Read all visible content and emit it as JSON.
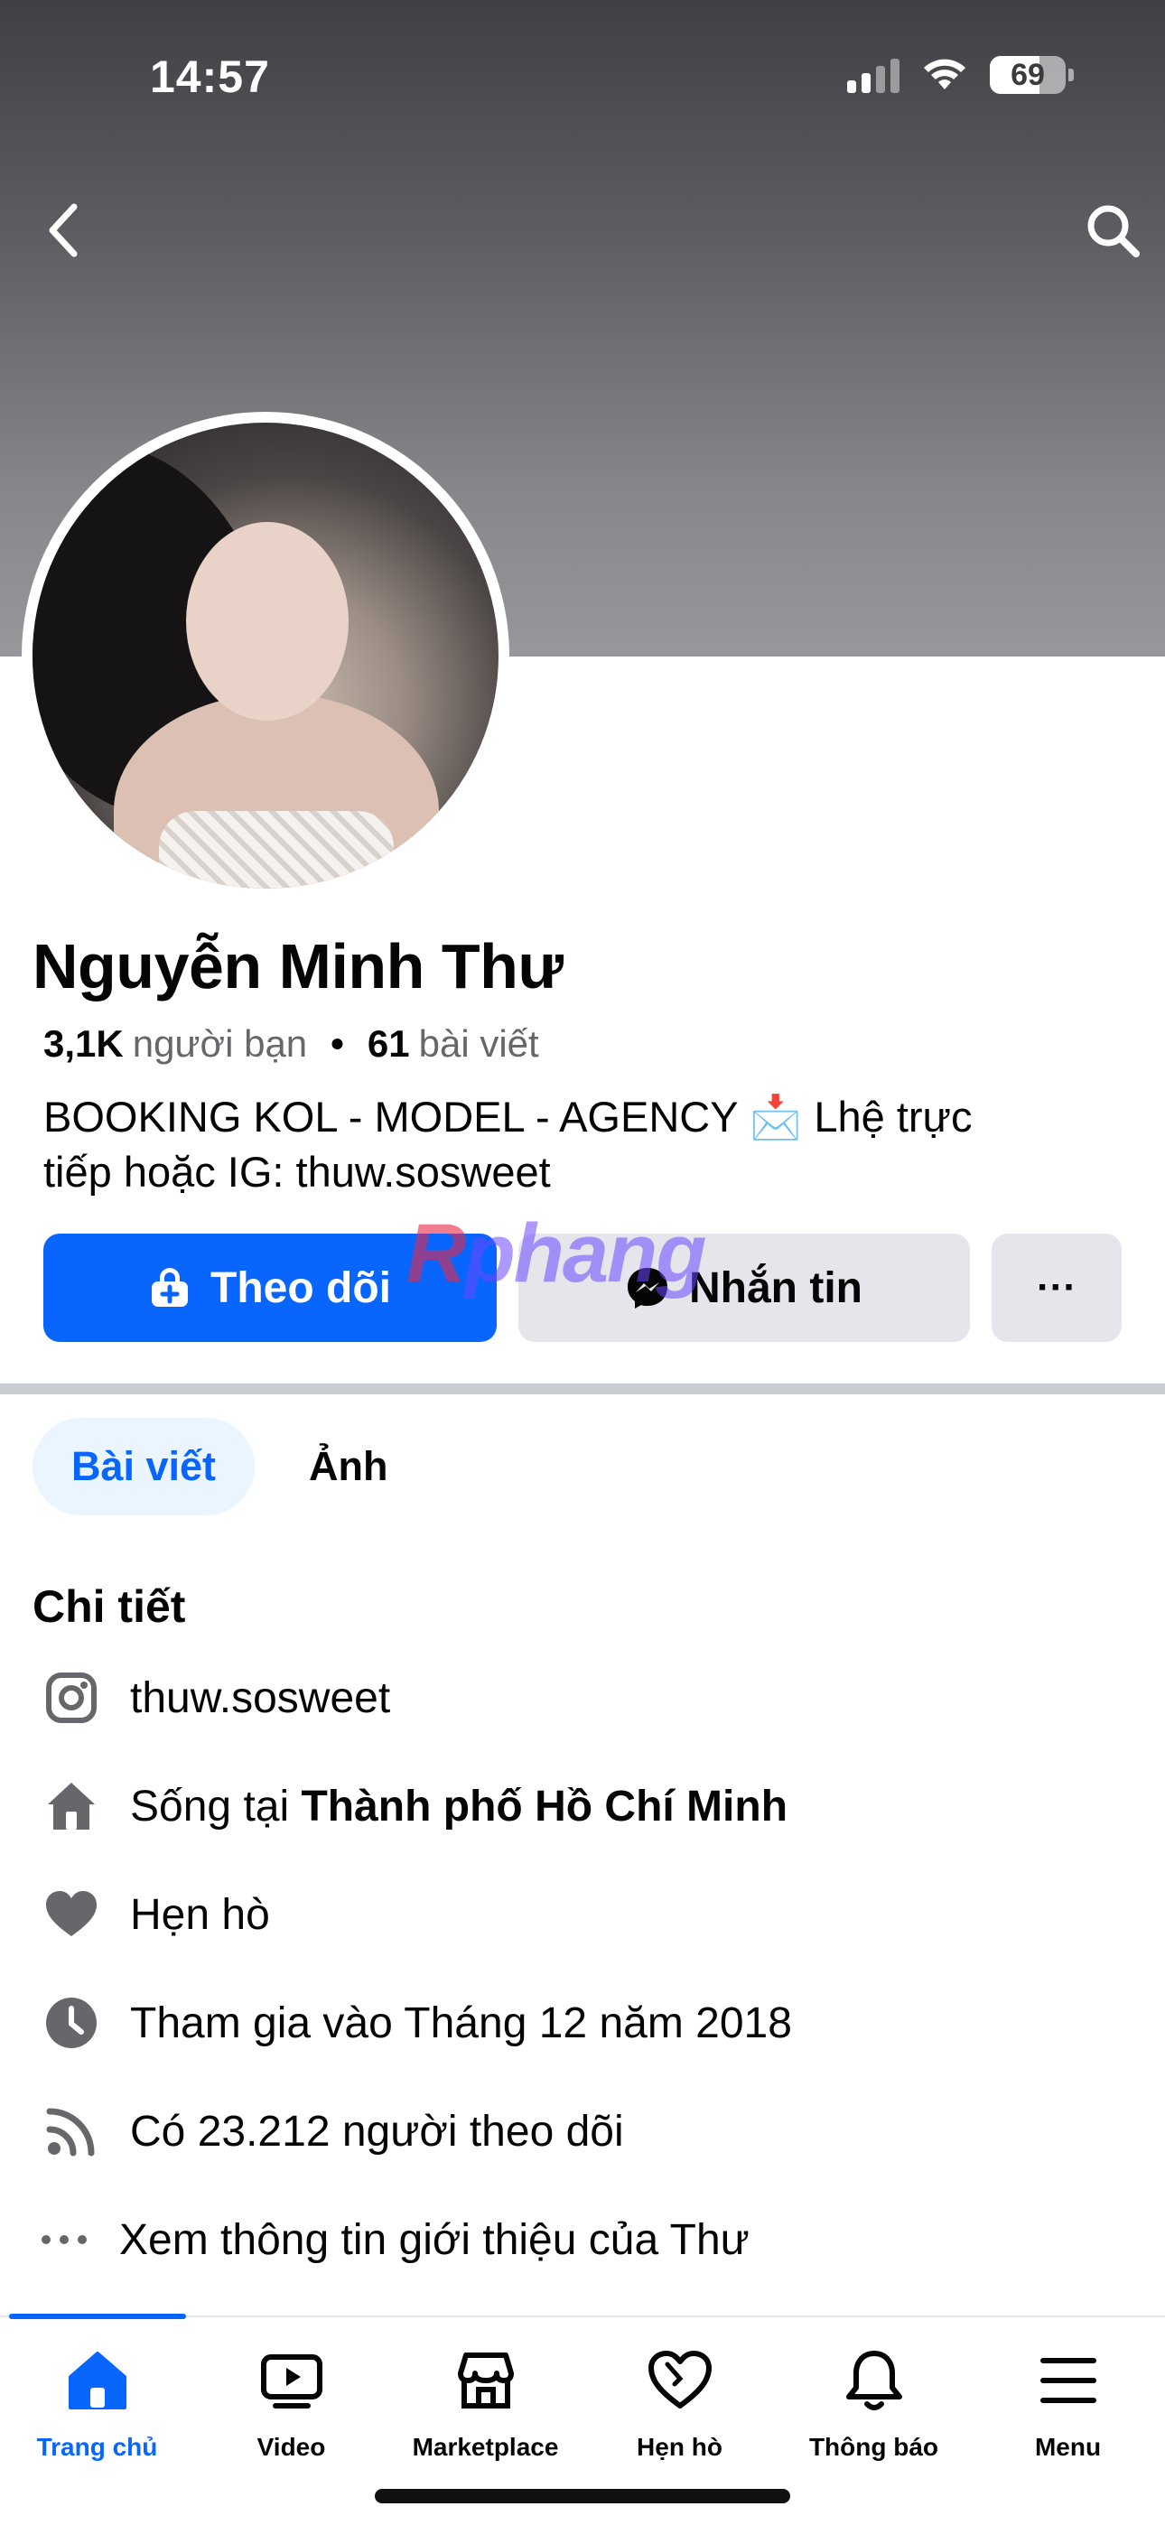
{
  "status_bar": {
    "time": "14:57",
    "battery": "69"
  },
  "profile": {
    "name": "Nguyễn Minh Thư",
    "friends_count": "3,1K",
    "friends_label": "người bạn",
    "posts_count": "61",
    "posts_label": "bài viết",
    "bio_line1": "BOOKING KOL - MODEL - AGENCY 📩 Lhệ trực",
    "bio_line2": "tiếp hoặc IG: thuw.sosweet"
  },
  "actions": {
    "follow_label": "Theo dõi",
    "message_label": "Nhắn tin",
    "more_label": "···"
  },
  "watermark": {
    "prefix": "R",
    "rest": "phang"
  },
  "tabs": [
    {
      "label": "Bài viết",
      "active": true
    },
    {
      "label": "Ảnh",
      "active": false
    }
  ],
  "details": {
    "title": "Chi tiết",
    "instagram": "thuw.sosweet",
    "lives_prefix": "Sống tại ",
    "lives_city": "Thành phố Hồ Chí Minh",
    "dating": "Hẹn hò",
    "joined": "Tham gia vào Tháng 12 năm 2018",
    "followers": "Có 23.212 người theo dõi",
    "see_about": "Xem thông tin giới thiệu của Thư"
  },
  "bottom_nav": [
    {
      "label": "Trang chủ",
      "icon": "home-icon",
      "active": true
    },
    {
      "label": "Video",
      "icon": "video-icon",
      "active": false
    },
    {
      "label": "Marketplace",
      "icon": "marketplace-icon",
      "active": false
    },
    {
      "label": "Hẹn hò",
      "icon": "dating-icon",
      "active": false
    },
    {
      "label": "Thông báo",
      "icon": "bell-icon",
      "active": false
    },
    {
      "label": "Menu",
      "icon": "menu-icon",
      "active": false
    }
  ],
  "colors": {
    "accent": "#0866ff",
    "secondary_button": "#e4e6eb",
    "muted_text": "#65676b"
  }
}
